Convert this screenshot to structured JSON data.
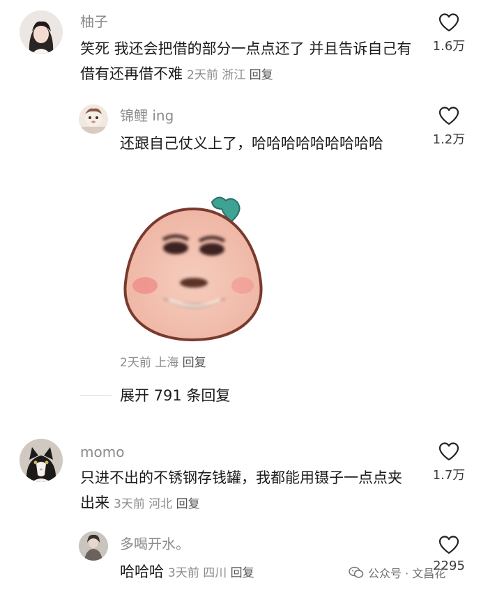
{
  "comments": [
    {
      "username": "柚子",
      "text": "笑死 我还会把借的部分一点点还了 并且告诉自己有借有还再借不难",
      "time": "2天前",
      "location": "浙江",
      "reply_label": "回复",
      "likes": "1.6万",
      "replies": [
        {
          "username": "锦鲤 ing",
          "text": "还跟自己仗义上了，哈哈哈哈哈哈哈哈哈",
          "time": "2天前",
          "location": "上海",
          "reply_label": "回复",
          "likes": "1.2万",
          "sticker": "peach-meme-face"
        }
      ],
      "expand_label": "展开 791 条回复"
    },
    {
      "username": "momo",
      "text": "只进不出的不锈钢存钱罐，我都能用镊子一点点夹出来",
      "time": "3天前",
      "location": "河北",
      "reply_label": "回复",
      "likes": "1.7万",
      "replies": [
        {
          "username": "多喝开水。",
          "text": "哈哈哈",
          "time": "3天前",
          "location": "四川",
          "reply_label": "回复",
          "likes": "2295"
        }
      ]
    }
  ],
  "watermark": {
    "text": "公众号 · 文昌花",
    "icon": "wechat-icon"
  },
  "colors": {
    "username": "#8b8b8b",
    "meta": "#8d8d8d",
    "text": "#1b1b1b",
    "peach": "#f0bca8",
    "leaf": "#3a9e8f"
  }
}
